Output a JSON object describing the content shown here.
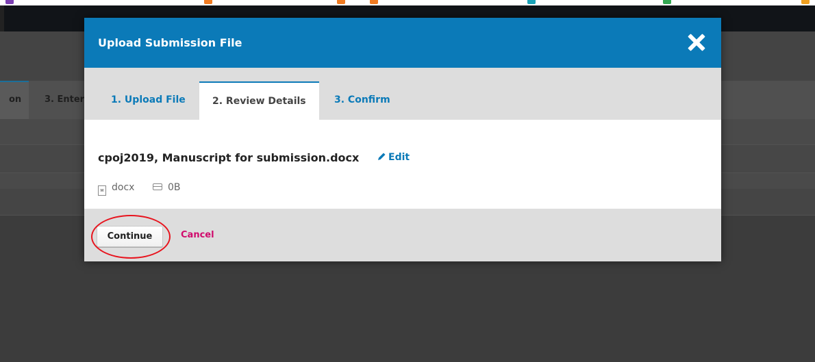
{
  "modal": {
    "title": "Upload Submission File",
    "tabs": [
      {
        "label": "1. Upload File",
        "active": false
      },
      {
        "label": "2. Review Details",
        "active": true
      },
      {
        "label": "3. Confirm",
        "active": false
      }
    ],
    "file": {
      "name": "cpoj2019, Manuscript for submission.docx",
      "edit_label": "Edit",
      "type": "docx",
      "size": "0B"
    },
    "footer": {
      "continue_label": "Continue",
      "cancel_label": "Cancel"
    }
  },
  "background_page": {
    "tabs": [
      {
        "label": "on"
      },
      {
        "label": "3. Enter"
      }
    ]
  },
  "colors": {
    "header_blue": "#0b7ab8",
    "cancel_pink": "#d00a6c",
    "highlight_red": "#e8141e"
  },
  "icons": [
    "close-icon",
    "pencil-icon",
    "word-file-icon",
    "drive-icon"
  ]
}
